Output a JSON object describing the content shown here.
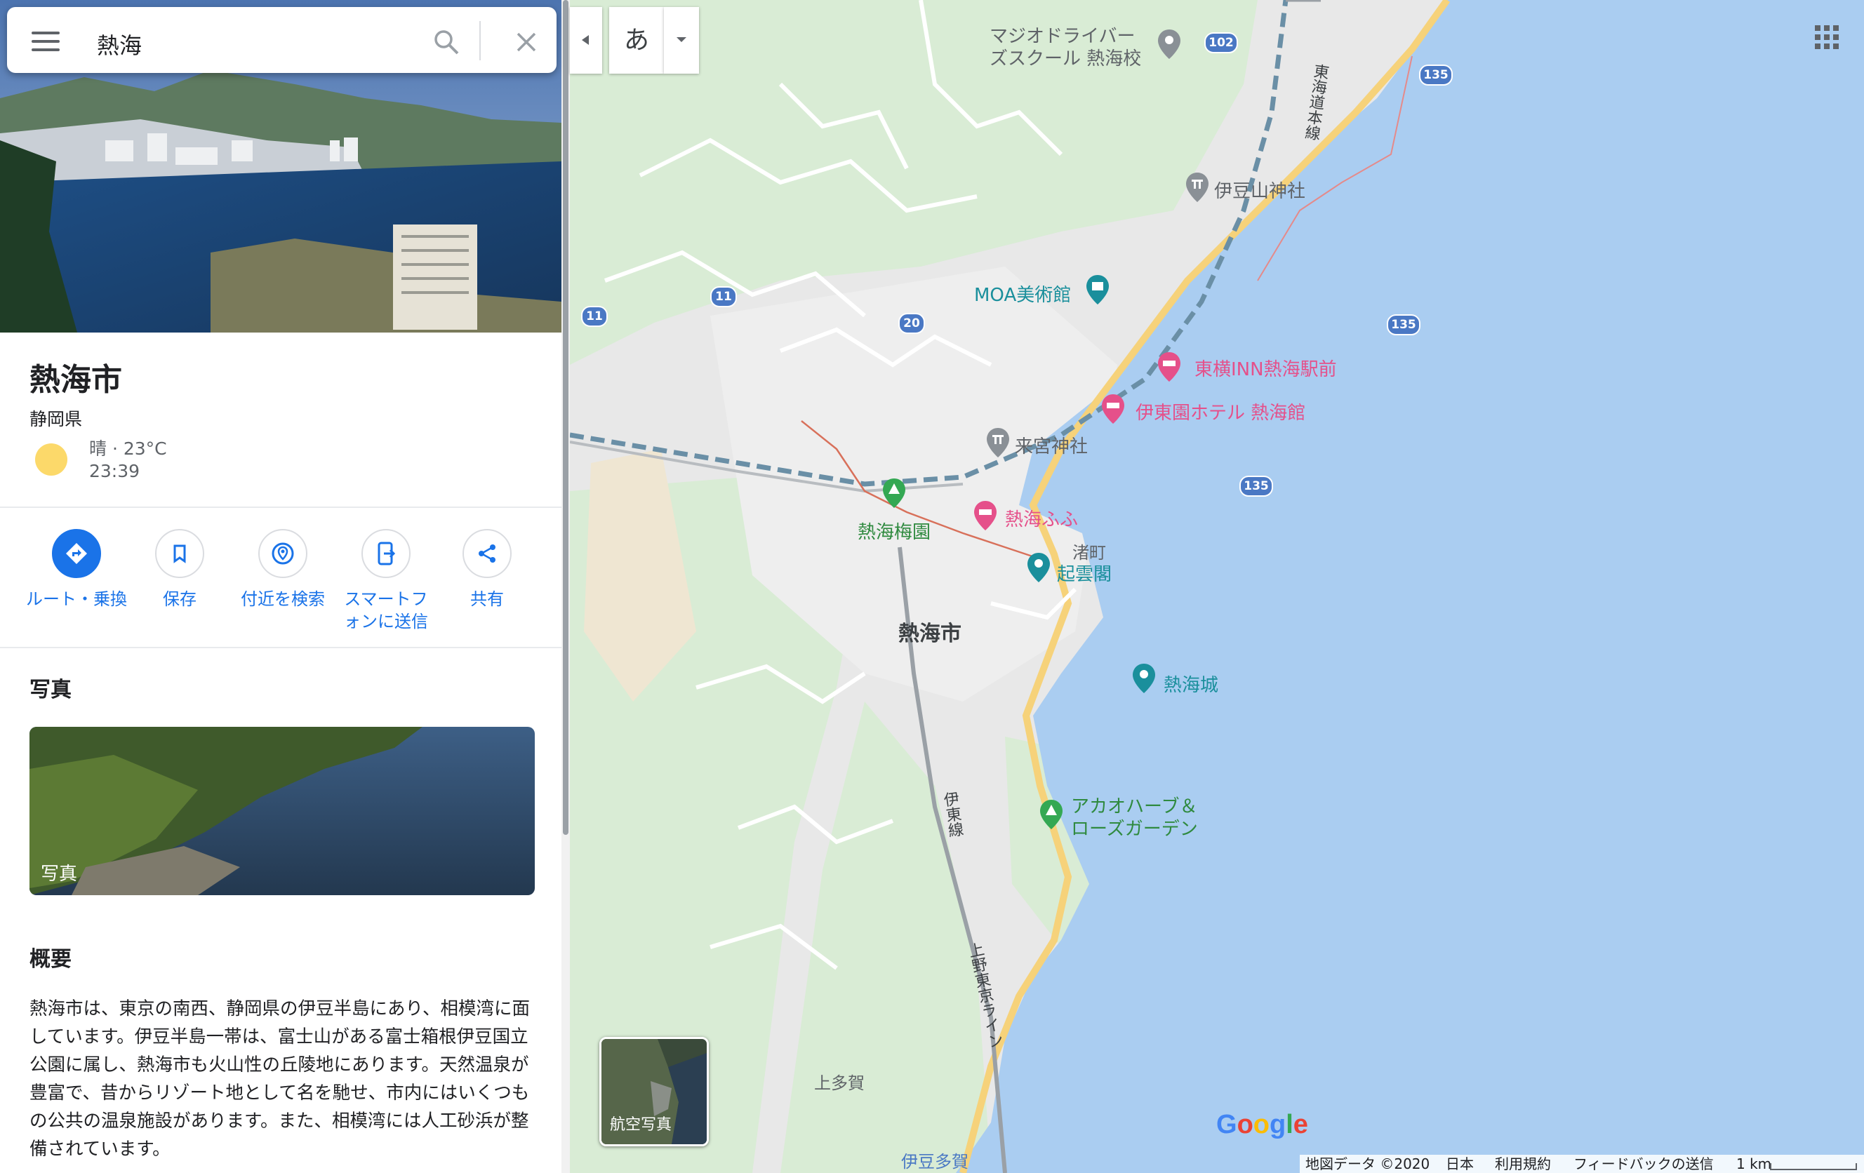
{
  "search": {
    "query": "熱海"
  },
  "place": {
    "name": "熱海市",
    "region": "静岡県",
    "weather": "晴 · 23°C",
    "time": "23:39"
  },
  "actions": [
    {
      "label": "ルート・乗換",
      "icon": "directions-icon"
    },
    {
      "label": "保存",
      "icon": "bookmark-icon"
    },
    {
      "label": "付近を検索",
      "icon": "nearby-icon"
    },
    {
      "label": "スマートフォンに送信",
      "icon": "send-to-phone-icon"
    },
    {
      "label": "共有",
      "icon": "share-icon"
    }
  ],
  "photos": {
    "heading": "写真",
    "tile_label": "写真"
  },
  "overview": {
    "heading": "概要",
    "text": "熱海市は、東京の南西、静岡県の伊豆半島にあり、相模湾に面しています。伊豆半島一帯は、富士山がある富士箱根伊豆国立公園に属し、熱海市も火山性の丘陵地にあります。天然温泉が豊富で、昔からリゾート地として名を馳せ、市内にはいくつもの公共の温泉施設があります。また、相模湾には人工砂浜が整備されています。"
  },
  "map": {
    "ime_label": "あ",
    "city_label": "熱海市",
    "pois": {
      "majio": "マジオドライバー\nズスクール 熱海校",
      "izusan": "伊豆山神社",
      "moa": "MOA美術館",
      "toyoko": "東横INN熱海駅前",
      "itoen": "伊東園ホテル 熱海館",
      "kinomiya": "来宮神社",
      "baien": "熱海梅園",
      "fufu": "熱海ふふ",
      "nagisa": "渚町",
      "kiunkaku": "起雲閣",
      "castle": "熱海城",
      "akao": "アカオハーブ＆\nローズガーデン",
      "kamitaga": "上多賀",
      "izutaga": "伊豆多賀"
    },
    "lines": {
      "tokaido": "東海道本線",
      "ito": "伊東線",
      "ueno_tokyo": "上野東京ライン"
    },
    "route_numbers": [
      "102",
      "135",
      "135",
      "135",
      "11",
      "11",
      "20"
    ],
    "aerial_label": "航空写真",
    "google": "Google",
    "footer": {
      "data": "地図データ ©2020",
      "country": "日本",
      "terms": "利用規約",
      "feedback": "フィードバックの送信",
      "scale": "1 km"
    }
  },
  "colors": {
    "accent": "#1a73e8",
    "sea": "#aacdf1",
    "land": "#e8e8e8",
    "park": "#d9ecd5"
  }
}
